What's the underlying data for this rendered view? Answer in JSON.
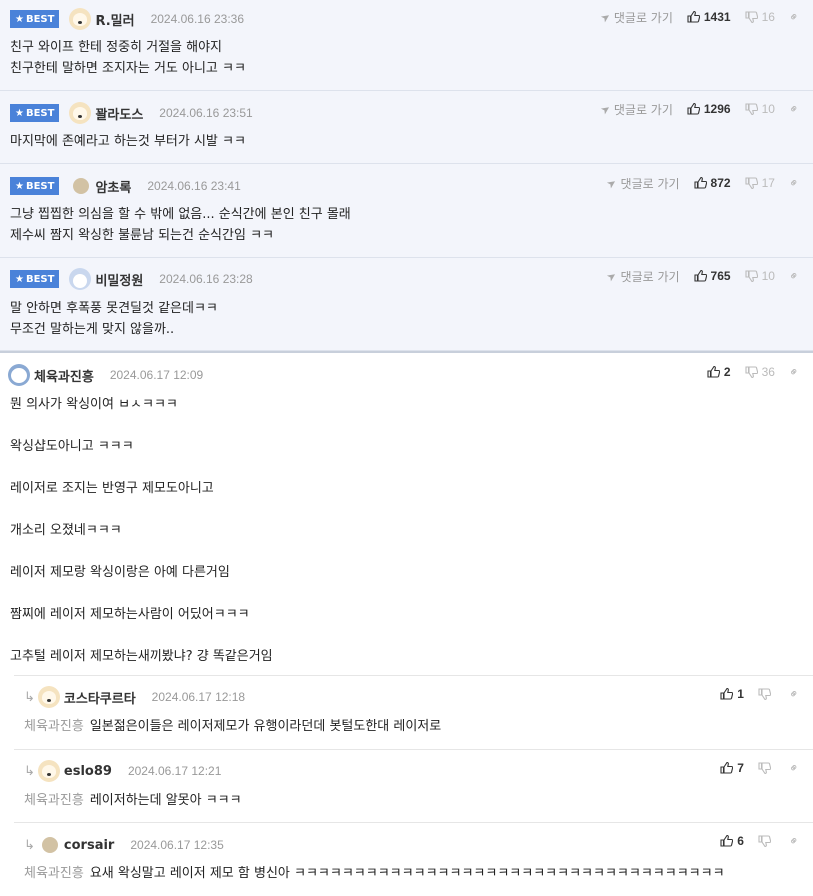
{
  "labels": {
    "best": "BEST",
    "goto_reply": "댓글로 가기"
  },
  "best_comments": [
    {
      "nick": "R.밀러",
      "avatar": "dog-icon",
      "date": "2024.06.16 23:36",
      "up": "1431",
      "down": "16",
      "lines": [
        "친구 와이프 한테 정중히 거절을 해야지",
        "친구한테 말하면 조지자는 거도 아니고 ㅋㅋ"
      ]
    },
    {
      "nick": "꽐라도스",
      "avatar": "dog-icon",
      "date": "2024.06.16 23:51",
      "up": "1296",
      "down": "10",
      "lines": [
        "마지막에 존예라고 하는것 부터가 시발 ㅋㅋ"
      ]
    },
    {
      "nick": "암초록",
      "avatar": "blob-icon",
      "date": "2024.06.16 23:41",
      "up": "872",
      "down": "17",
      "lines": [
        "그냥 찝찝한 의심을 할 수 밖에 없음... 순식간에 본인 친구 몰래",
        "제수씨 짬지 왁싱한 불륜남 되는건 순식간임 ㅋㅋ"
      ]
    },
    {
      "nick": "비밀정원",
      "avatar": "bear-icon",
      "date": "2024.06.16 23:28",
      "up": "765",
      "down": "10",
      "lines": [
        "말 안하면 후폭풍 못견딜것 같은데ㅋㅋ",
        "무조건 말하는게 맞지 않을까.."
      ]
    }
  ],
  "main_comment": {
    "nick": "체육과진흥",
    "avatar": "seal-icon",
    "date": "2024.06.17 12:09",
    "up": "2",
    "down": "36",
    "paragraphs": [
      "뭔 의사가 왁싱이여 ㅂㅅㅋㅋㅋ",
      "왁싱샵도아니고 ㅋㅋㅋ",
      "레이저로 조지는 반영구 제모도아니고",
      "개소리 오졌네ㅋㅋㅋ",
      "레이저 제모랑 왁싱이랑은 아예 다른거임",
      "짬찌에 레이저 제모하는사람이 어딨어ㅋㅋㅋ",
      "고추털 레이저 제모하는새끼봤냐? 걍 똑같은거임"
    ]
  },
  "replies": [
    {
      "nick": "코스타쿠르타",
      "avatar": "dog-icon",
      "date": "2024.06.17 12:18",
      "up": "1",
      "down": "",
      "mention": "체육과진흥",
      "text": "일본젊은이들은 레이저제모가 유행이라던데 봇털도한대 레이저로"
    },
    {
      "nick": "eslo89",
      "avatar": "dog-icon",
      "date": "2024.06.17 12:21",
      "up": "7",
      "down": "",
      "mention": "체육과진흥",
      "text": "레이저하는데 알못아 ㅋㅋㅋ"
    },
    {
      "nick": "corsair",
      "avatar": "blob-icon",
      "date": "2024.06.17 12:35",
      "up": "6",
      "down": "",
      "mention": "체육과진흥",
      "text": "요새 왁싱말고 레이저 제모 함 병신아 ㅋㅋㅋㅋㅋㅋㅋㅋㅋㅋㅋㅋㅋㅋㅋㅋㅋㅋㅋㅋㅋㅋㅋㅋㅋㅋㅋㅋㅋㅋㅋㅋㅋㅋㅋㅋ"
    }
  ]
}
